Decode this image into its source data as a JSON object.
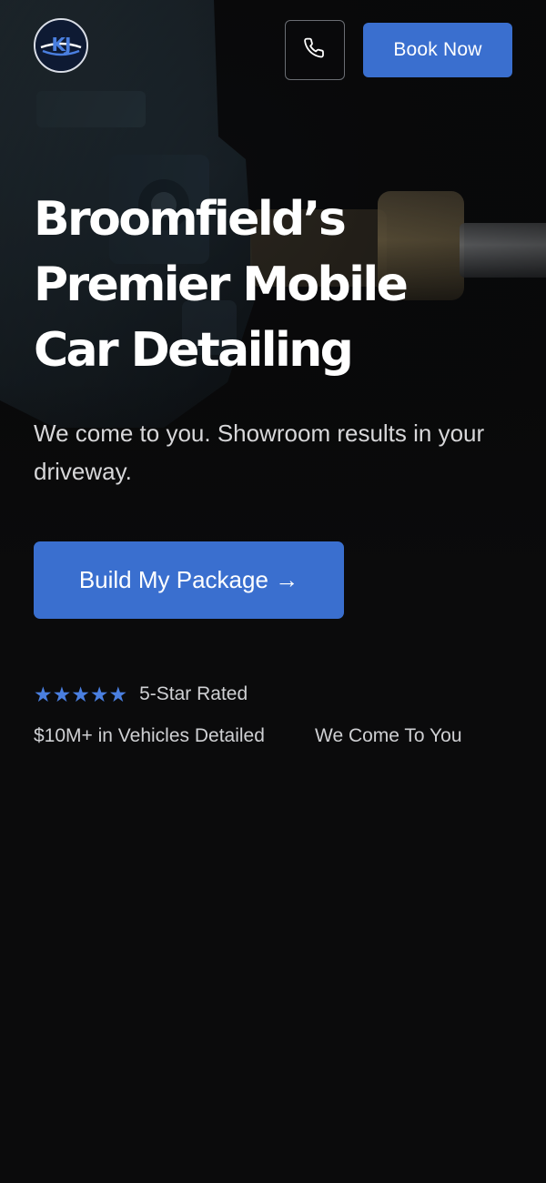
{
  "header": {
    "logo_text": "KJ",
    "phone_icon": "phone-icon",
    "book_label": "Book Now"
  },
  "hero": {
    "headline_lines": [
      "Broomfield’s",
      "Premier Mobile",
      "Car Detailing"
    ],
    "subhead": "We come to you. Showroom results in your driveway.",
    "cta_label": "Build My Package →"
  },
  "trust": {
    "stars": "★★★★★",
    "rating_label": "5-Star Rated",
    "items": [
      "$10M+ in Vehicles Detailed",
      "We Come To You"
    ]
  },
  "colors": {
    "accent": "#3a6fcf",
    "star": "#4a7fe0",
    "background": "#0b0b0c"
  }
}
